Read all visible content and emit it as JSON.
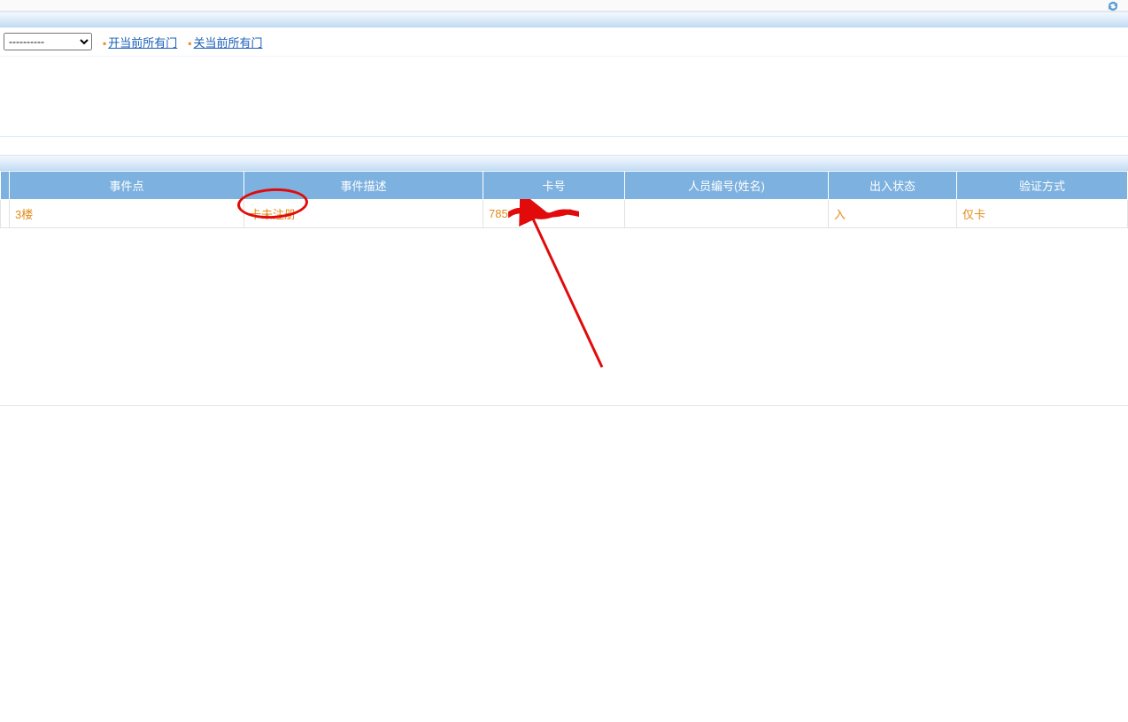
{
  "toolbar": {
    "area_select_placeholder": "----------",
    "open_all_doors": "开当前所有门",
    "close_all_doors": "关当前所有门"
  },
  "table": {
    "headers": {
      "event_point": "事件点",
      "event_desc": "事件描述",
      "card_no": "卡号",
      "person": "人员编号(姓名)",
      "io_state": "出入状态",
      "verify_mode": "验证方式"
    },
    "rows": [
      {
        "event_point": "3楼",
        "event_desc": "卡未注册",
        "card_no_prefix": "785",
        "person": "",
        "io_state": "入",
        "verify_mode": "仅卡"
      }
    ]
  }
}
